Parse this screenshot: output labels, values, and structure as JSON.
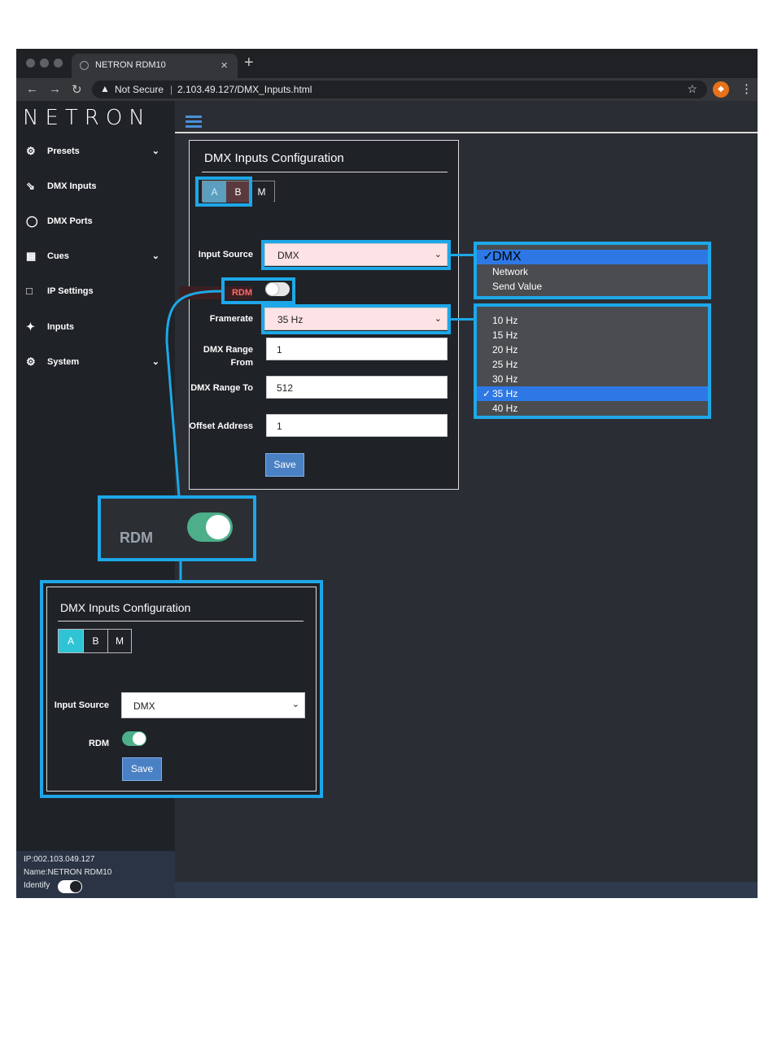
{
  "browser": {
    "tab_title": "NETRON RDM10",
    "tab_close": "×",
    "new_tab": "+",
    "security_label": "Not Secure",
    "url": "2.103.49.127/DMX_Inputs.html"
  },
  "app": {
    "logo": "NETRON",
    "sidebar": {
      "items": [
        {
          "label": "Presets",
          "icon": "gear-icon",
          "has_chevron": true
        },
        {
          "label": "DMX Inputs",
          "icon": "arrow-in-icon",
          "has_chevron": false
        },
        {
          "label": "DMX Ports",
          "icon": "power-icon",
          "has_chevron": false
        },
        {
          "label": "Cues",
          "icon": "film-icon",
          "has_chevron": true
        },
        {
          "label": "IP Settings",
          "icon": "laptop-icon",
          "has_chevron": false
        },
        {
          "label": "Inputs",
          "icon": "plug-icon",
          "has_chevron": false
        },
        {
          "label": "System",
          "icon": "gear-icon",
          "has_chevron": true
        }
      ]
    },
    "footer": {
      "ip": "IP:002.103.049.127",
      "name": "Name:NETRON RDM10",
      "identify": "Identify"
    }
  },
  "panel": {
    "title": "DMX Inputs Configuration",
    "tabs": [
      "A",
      "B",
      "M"
    ],
    "fields": {
      "input_source_label": "Input Source",
      "input_source_value": "DMX",
      "rdm_label": "RDM",
      "framerate_label": "Framerate",
      "framerate_value": "35 Hz",
      "range_from_label": "DMX Range From",
      "range_from_value": "1",
      "range_to_label": "DMX Range To",
      "range_to_value": "512",
      "offset_label": "Offset Address",
      "offset_value": "1"
    },
    "save_label": "Save"
  },
  "dropdowns": {
    "input_source_options": [
      "DMX",
      "Network",
      "Send Value"
    ],
    "input_source_selected": "DMX",
    "framerate_options": [
      "10 Hz",
      "15 Hz",
      "20 Hz",
      "25 Hz",
      "30 Hz",
      "35 Hz",
      "40 Hz"
    ],
    "framerate_selected": "35 Hz",
    "check_mark": "✓"
  },
  "callout_rdm": {
    "label": "RDM",
    "state": "on"
  },
  "callout_panel": {
    "title": "DMX Inputs Configuration",
    "tabs": [
      "A",
      "B",
      "M"
    ],
    "input_source_label": "Input Source",
    "input_source_value": "DMX",
    "rdm_label": "RDM",
    "save_label": "Save"
  },
  "colors": {
    "highlight": "#1ea7e8",
    "accent": "#4a80c4",
    "toggle_on": "#4caf8a",
    "sidebar_bg": "#1f2227"
  }
}
